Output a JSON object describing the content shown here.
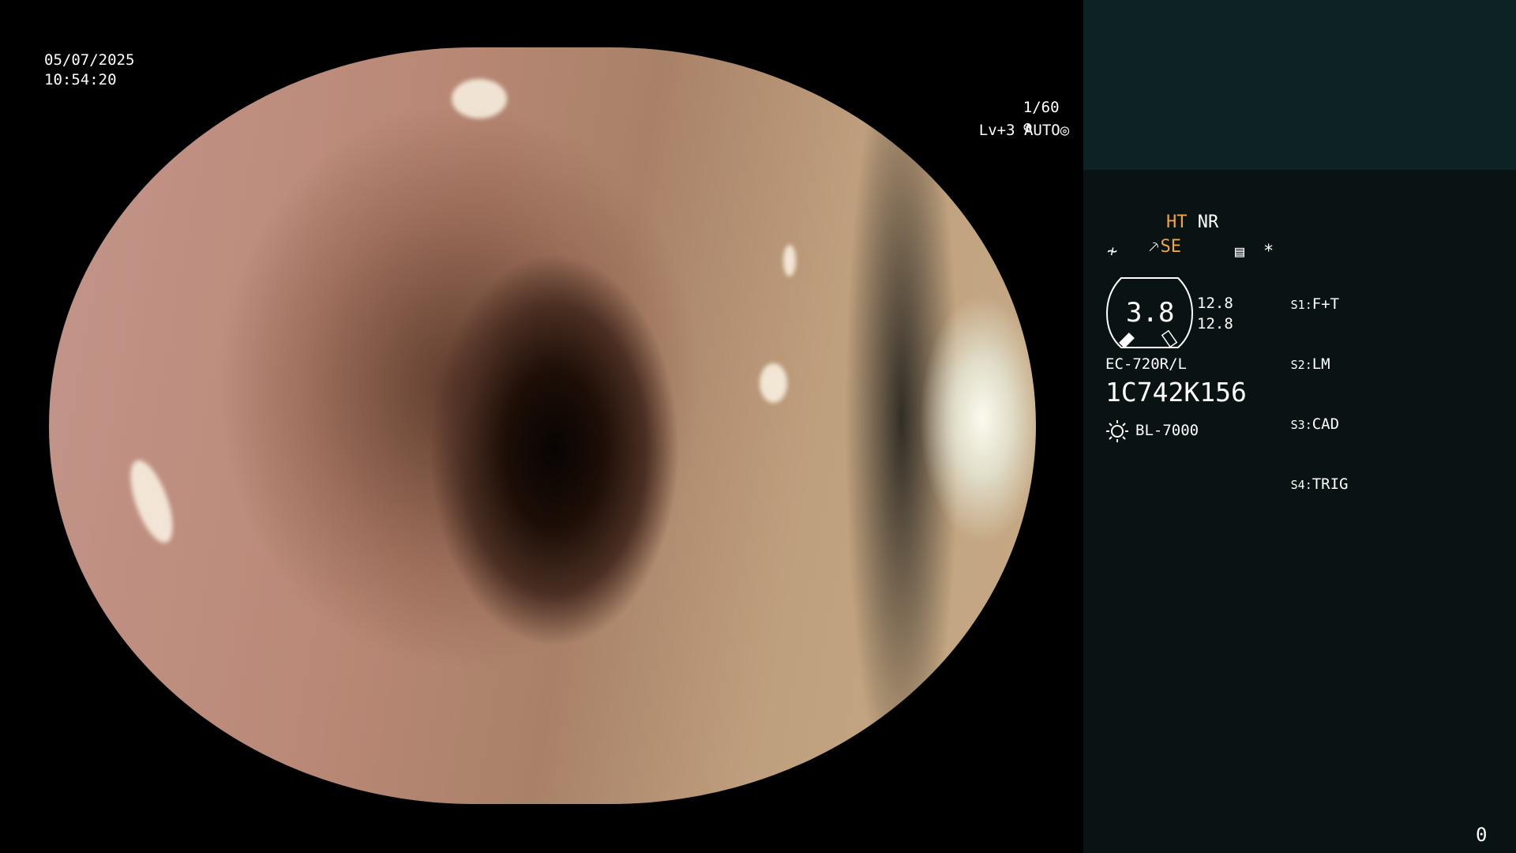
{
  "capture": {
    "date": "05/07/2025",
    "time": "10:54:20"
  },
  "exposure": {
    "shutter": "1/60",
    "level": "Lv+3",
    "mode": "AUTO"
  },
  "settings": {
    "ht": "HT",
    "nr": "NR",
    "se": "SE"
  },
  "gauge": {
    "value": "3.8",
    "left_top": "12.8",
    "left_bottom": "12.8"
  },
  "switches": [
    {
      "key": "S1",
      "value": "F+T"
    },
    {
      "key": "S2",
      "value": "LM"
    },
    {
      "key": "S3",
      "value": "CAD"
    },
    {
      "key": "S4",
      "value": "TRIG"
    }
  ],
  "scope": {
    "model": "EC-720R/L",
    "serial": "1C742K156"
  },
  "light": {
    "source": "BL-7000"
  },
  "counter": "0",
  "colors": {
    "accent": "#f3a63a",
    "panel": "#0a1313",
    "panel_top": "#0c2223"
  },
  "icons": {
    "shutter": "aperture-icon",
    "auto": "iris-icon",
    "light": "sun-icon"
  }
}
